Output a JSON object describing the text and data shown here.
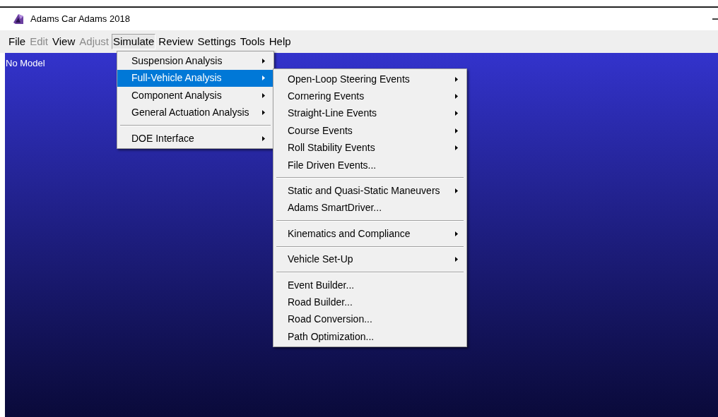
{
  "window": {
    "title": "Adams Car Adams 2018"
  },
  "menu_bar": [
    {
      "label": "File",
      "disabled": false,
      "selected": false
    },
    {
      "label": "Edit",
      "disabled": true,
      "selected": false
    },
    {
      "label": "View",
      "disabled": false,
      "selected": false
    },
    {
      "label": "Adjust",
      "disabled": true,
      "selected": false
    },
    {
      "label": "Simulate",
      "disabled": false,
      "selected": true
    },
    {
      "label": "Review",
      "disabled": false,
      "selected": false
    },
    {
      "label": "Settings",
      "disabled": false,
      "selected": false
    },
    {
      "label": "Tools",
      "disabled": false,
      "selected": false
    },
    {
      "label": "Help",
      "disabled": false,
      "selected": false
    }
  ],
  "canvas": {
    "label": "No Model"
  },
  "simulate_menu": [
    {
      "kind": "item",
      "label": "Suspension Analysis",
      "submenu": true,
      "selected": false
    },
    {
      "kind": "item",
      "label": "Full-Vehicle Analysis",
      "submenu": true,
      "selected": true
    },
    {
      "kind": "item",
      "label": "Component Analysis",
      "submenu": true,
      "selected": false
    },
    {
      "kind": "item",
      "label": "General Actuation Analysis",
      "submenu": true,
      "selected": false
    },
    {
      "kind": "separator"
    },
    {
      "kind": "item",
      "label": "DOE Interface",
      "submenu": true,
      "selected": false
    }
  ],
  "full_vehicle_submenu": [
    {
      "kind": "item",
      "label": "Open-Loop Steering Events",
      "submenu": true,
      "selected": false
    },
    {
      "kind": "item",
      "label": "Cornering Events",
      "submenu": true,
      "selected": false
    },
    {
      "kind": "item",
      "label": "Straight-Line Events",
      "submenu": true,
      "selected": false
    },
    {
      "kind": "item",
      "label": "Course Events",
      "submenu": true,
      "selected": false
    },
    {
      "kind": "item",
      "label": "Roll Stability Events",
      "submenu": true,
      "selected": false
    },
    {
      "kind": "item",
      "label": "File Driven Events...",
      "submenu": false,
      "selected": false
    },
    {
      "kind": "separator"
    },
    {
      "kind": "item",
      "label": "Static and Quasi-Static Maneuvers",
      "submenu": true,
      "selected": false
    },
    {
      "kind": "item",
      "label": "Adams SmartDriver...",
      "submenu": false,
      "selected": false
    },
    {
      "kind": "separator"
    },
    {
      "kind": "item",
      "label": "Kinematics and Compliance",
      "submenu": true,
      "selected": false
    },
    {
      "kind": "separator"
    },
    {
      "kind": "item",
      "label": "Vehicle Set-Up",
      "submenu": true,
      "selected": false
    },
    {
      "kind": "separator"
    },
    {
      "kind": "item",
      "label": "Event Builder...",
      "submenu": false,
      "selected": false
    },
    {
      "kind": "item",
      "label": "Road Builder...",
      "submenu": false,
      "selected": false
    },
    {
      "kind": "item",
      "label": "Road Conversion...",
      "submenu": false,
      "selected": false
    },
    {
      "kind": "item",
      "label": "Path Optimization...",
      "submenu": false,
      "selected": false
    }
  ]
}
